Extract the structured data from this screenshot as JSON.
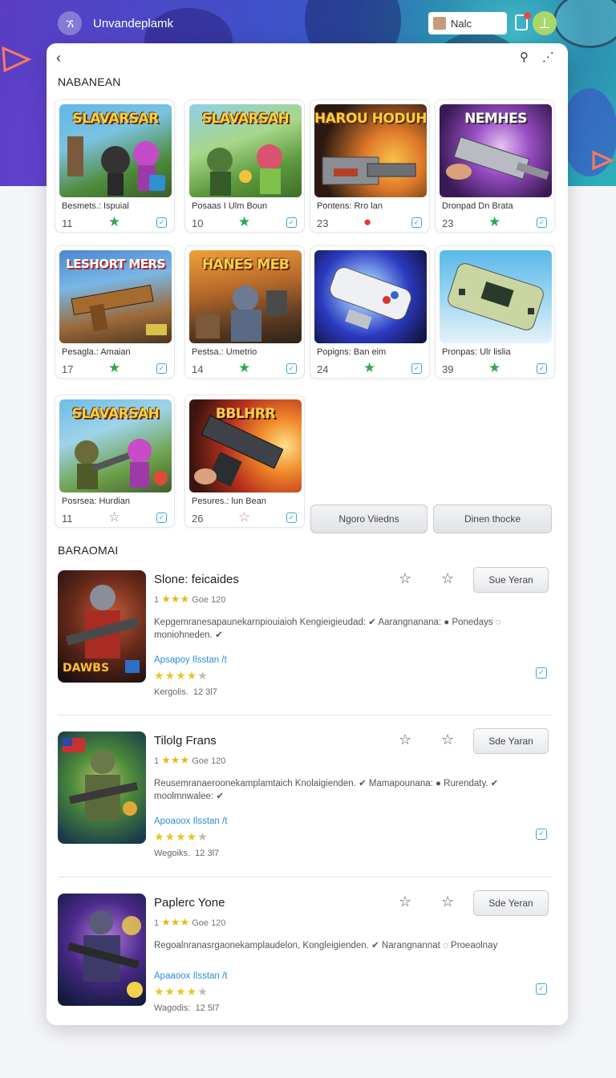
{
  "topbar": {
    "logo_glyph": "ኧ",
    "title": "Unvandeplamk",
    "user_name": "Nalc",
    "menu_glyph": "⊥"
  },
  "card": {
    "back_glyph": "‹",
    "search_glyph": "⚲",
    "more_glyph": "⋰"
  },
  "grid_section": {
    "title": "NABANEAN",
    "tiles": [
      {
        "art_title": "SLAVARSAR",
        "name": "Besmets.: Ispuial",
        "count": "11",
        "star": "★",
        "star_style": "green"
      },
      {
        "art_title": "SLAVARSAH",
        "name": "Posaas I Ulm Boun",
        "count": "10",
        "star": "★",
        "star_style": "green"
      },
      {
        "art_title": "HAROU HODUH",
        "name": "Pontens: Rro lan",
        "count": "23",
        "star": "●",
        "star_style": "red"
      },
      {
        "art_title": "NEMHES",
        "name": "Dronpad Dn Brata",
        "count": "23",
        "star": "★",
        "star_style": "green"
      },
      {
        "art_title": "LESHORT MERS",
        "name": "Pesagla.: Amaian",
        "count": "17",
        "star": "★",
        "star_style": "green"
      },
      {
        "art_title": "HANES MEB",
        "name": "Pestsa.: Umetrio",
        "count": "14",
        "star": "★",
        "star_style": "green"
      },
      {
        "art_title": "",
        "name": "Popigns: Ban eim",
        "count": "24",
        "star": "★",
        "star_style": "green"
      },
      {
        "art_title": "",
        "name": "Pronpas: Ulr lislia",
        "count": "39",
        "star": "★",
        "star_style": "green"
      },
      {
        "art_title": "SLAVARSAH",
        "name": "Posrsea: Hurdian",
        "count": "11",
        "star": "☆",
        "star_style": "outline"
      },
      {
        "art_title": "BBLHRR",
        "name": "Pesures.: lun Bean",
        "count": "26",
        "star": "☆",
        "star_style": "pink"
      }
    ],
    "button_left": "Ngoro Viiedns",
    "button_right": "Dinen thocke"
  },
  "list_section": {
    "title": "BARAOMAI",
    "rows": [
      {
        "title": "Slone: feicaides",
        "meta_num": "1",
        "meta_stars": "★★★",
        "meta_text": "Goe 120",
        "desc": "Kepgemranesapaunekarnpiouiaioh Kengieigieudad: ✔ Aarangnanana: ● Ponedays ◌ moniohneden. ✔",
        "link": "Apsapoy Ilsstan /t",
        "rating_on": "★★★★",
        "rating_off": "★",
        "sub_label": "Kergolis.",
        "sub_value": "12 3l7",
        "button": "Sue Yeran",
        "art_label": "DAWBS"
      },
      {
        "title": "Tilolg Frans",
        "meta_num": "1",
        "meta_stars": "★★★",
        "meta_text": "Goe 120",
        "desc": "Reusemranaeroonekamplamtaich Knolaigienden. ✔ Mamapounana: ● Rurendaty. ✔ moolmnwalee: ✔",
        "link": "Apoaoox Ilsstan /t",
        "rating_on": "★★★★",
        "rating_off": "★",
        "sub_label": "Wegoiks.",
        "sub_value": "12 3l7",
        "button": "Sde Yaran",
        "art_label": ""
      },
      {
        "title": "Paplerc Yone",
        "meta_num": "1",
        "meta_stars": "★★★",
        "meta_text": "Goe 120",
        "desc": "Regoalnranasrgaonekamplaudelon, Kongleigienden. ✔ Narangnannat ◌ Proeaolnay",
        "link": "Apaaoox Ilsstan /t",
        "rating_on": "★★★★",
        "rating_off": "★",
        "sub_label": "Wagodis:",
        "sub_value": "12 5l7",
        "button": "Sde Yeran",
        "art_label": ""
      }
    ]
  },
  "colors": {
    "accent_blue": "#3ba7d4",
    "star_green": "#2fa84f",
    "star_gold": "#e8c52a",
    "banner_purple": "#5a3dc4",
    "banner_teal": "#2cb2b8"
  }
}
